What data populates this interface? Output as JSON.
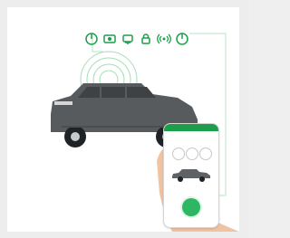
{
  "feature_icons": [
    {
      "name": "engine-start-icon"
    },
    {
      "name": "camera-icon"
    },
    {
      "name": "vehicle-status-icon"
    },
    {
      "name": "lock-icon"
    },
    {
      "name": "signal-icon"
    },
    {
      "name": "power-icon"
    }
  ],
  "phone": {
    "header": "",
    "label": ""
  },
  "colors": {
    "accent": "#1b9f4a",
    "accent_light": "#dff5e6",
    "car": "#585b5e",
    "background": "#ffffff"
  }
}
